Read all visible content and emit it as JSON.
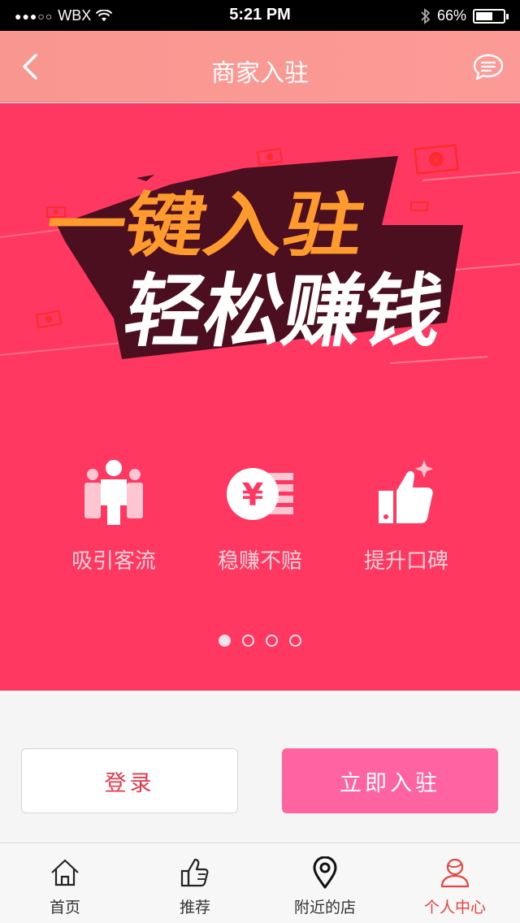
{
  "status_bar": {
    "carrier": "WBX",
    "time": "5:21 PM",
    "battery": "66%",
    "battery_level": 0.66
  },
  "nav": {
    "title": "商家入驻",
    "back_icon": "chevron-left-icon",
    "message_icon": "chat-bubble-icon"
  },
  "banner": {
    "headline_line1": "一键入驻",
    "headline_line2": "轻松赚钱",
    "features": [
      {
        "label": "吸引客流",
        "icon": "people-icon"
      },
      {
        "label": "稳赚不赔",
        "icon": "yen-coin-icon"
      },
      {
        "label": "提升口碑",
        "icon": "thumbs-up-icon"
      }
    ],
    "page_count": 4,
    "active_page": 1
  },
  "actions": {
    "login_label": "登录",
    "join_label": "立即入驻"
  },
  "tabs": [
    {
      "label": "首页",
      "icon": "home-icon",
      "active": false
    },
    {
      "label": "推荐",
      "icon": "thumbs-up-icon",
      "active": false
    },
    {
      "label": "附近的店",
      "icon": "location-pin-icon",
      "active": false
    },
    {
      "label": "个人中心",
      "icon": "user-icon",
      "active": true
    }
  ],
  "colors": {
    "banner_bg": "#fe3860",
    "nav_bg": "#f8978f",
    "headline_orange": "#ff9a2e",
    "join_button": "#ff64a0",
    "active_tab": "#e5443f"
  }
}
